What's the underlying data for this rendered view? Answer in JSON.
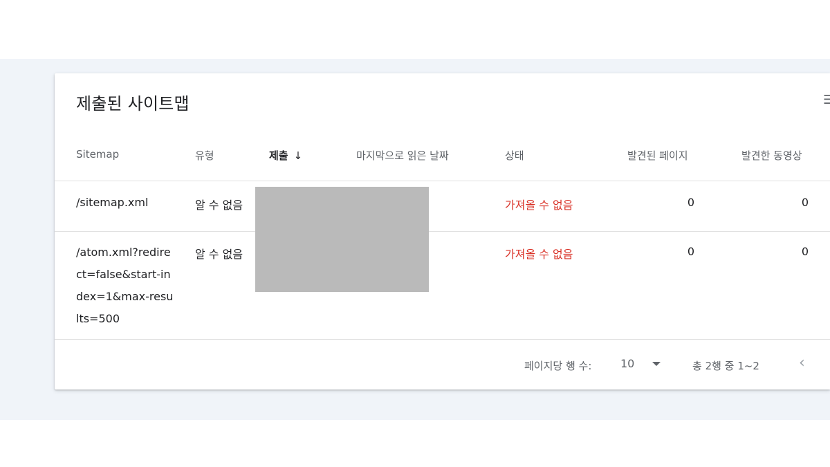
{
  "card": {
    "title": "제출된 사이트맵",
    "edge_icon": "filter-icon"
  },
  "table": {
    "headers": {
      "sitemap": "Sitemap",
      "type": "유형",
      "submitted": "제출",
      "last_read": "마지막으로 읽은 날짜",
      "status": "상태",
      "pages": "발견된 페이지",
      "videos": "발견한 동영상"
    },
    "sort_icon": "arrow-down-icon",
    "rows": [
      {
        "sitemap": "/sitemap.xml",
        "type": "알 수 없음",
        "status": "가져올 수 없음",
        "pages": "0",
        "videos": "0"
      },
      {
        "sitemap": "/atom.xml?redirect=false&start-index=1&max-results=500",
        "type": "알 수 없음",
        "status": "가져올 수 없음",
        "pages": "0",
        "videos": "0"
      }
    ]
  },
  "footer": {
    "rows_per_page_label": "페이지당 행 수:",
    "rows_per_page_value": "10",
    "range_text": "총 2행 중 1~2",
    "prev_icon": "chevron-left-icon"
  },
  "colors": {
    "page_bg": "#f0f4f9",
    "error": "#d93025",
    "redaction": "#bababa"
  }
}
